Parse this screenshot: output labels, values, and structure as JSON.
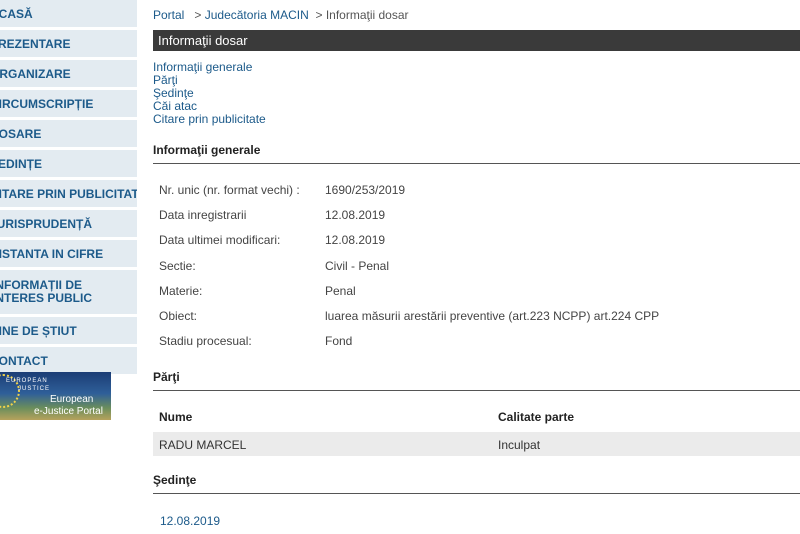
{
  "sidebar": {
    "items": [
      {
        "label": "ACASĂ"
      },
      {
        "label": "PREZENTARE"
      },
      {
        "label": "ORGANIZARE"
      },
      {
        "label": "CIRCUMSCRIPȚIE"
      },
      {
        "label": "DOSARE"
      },
      {
        "label": "ȘEDINȚE"
      },
      {
        "label": "CITARE PRIN PUBLICITATE"
      },
      {
        "label": "JURISPRUDENȚĂ"
      },
      {
        "label": "INSTANTA IN CIFRE"
      },
      {
        "label": "INFORMAȚII DE INTERES PUBLIC"
      },
      {
        "label": "BINE DE ȘTIUT"
      },
      {
        "label": "CONTACT"
      }
    ],
    "banner": {
      "small1": "EUROPEAN",
      "small2": "JUSTICE",
      "big1": "European",
      "big2": "e-Justice Portal"
    }
  },
  "breadcrumb": {
    "portal": "Portal",
    "court": "Judecătoria MACIN",
    "current": "Informaţii dosar",
    "sep": ">"
  },
  "page_title": "Informaţii dosar",
  "anchors": [
    "Informaţii generale",
    "Părţi",
    "Şedinţe",
    "Căi atac",
    "Citare prin publicitate"
  ],
  "general": {
    "heading": "Informaţii generale",
    "rows": [
      {
        "label": "Nr. unic (nr. format vechi) :",
        "value": "1690/253/2019"
      },
      {
        "label": "Data inregistrarii",
        "value": "12.08.2019"
      },
      {
        "label": "Data ultimei modificari:",
        "value": "12.08.2019"
      },
      {
        "label": "Sectie:",
        "value": "Civil - Penal"
      },
      {
        "label": "Materie:",
        "value": "Penal"
      },
      {
        "label": "Obiect:",
        "value": "luarea măsurii arestării preventive (art.223 NCPP) art.224 CPP"
      },
      {
        "label": "Stadiu procesual:",
        "value": "Fond"
      }
    ]
  },
  "parti": {
    "heading": "Părţi",
    "columns": [
      "Nume",
      "Calitate parte"
    ],
    "rows": [
      [
        "RADU MARCEL",
        "Inculpat"
      ]
    ]
  },
  "sedinte": {
    "heading": "Şedinţe",
    "dates": [
      "12.08.2019"
    ]
  }
}
